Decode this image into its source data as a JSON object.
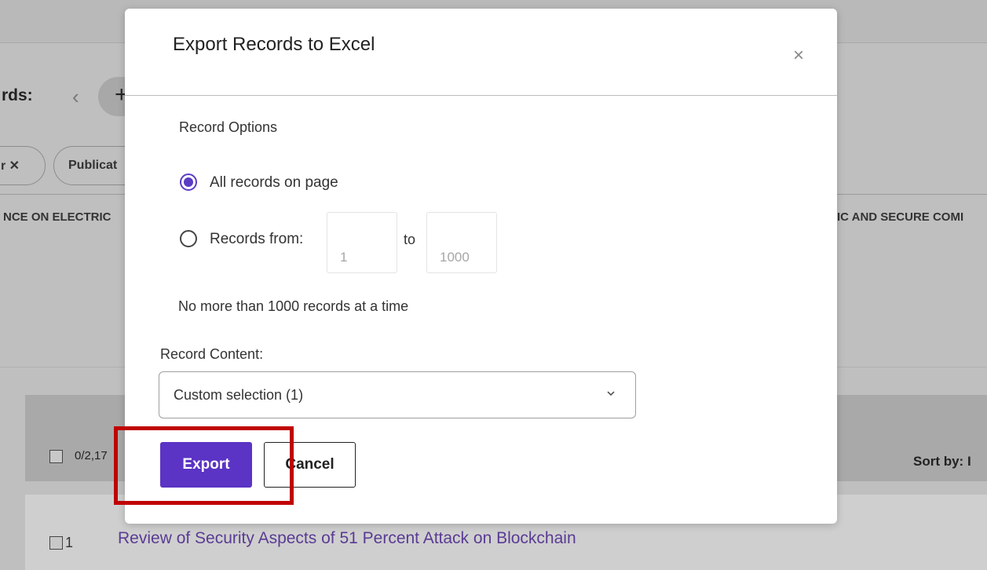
{
  "background": {
    "records_label": "rds:",
    "chevron_left": "‹",
    "plus": "+",
    "chip_author_close": "r ✕",
    "chip_publication": "Publicat",
    "banner_left": "NCE ON ELECTRIC",
    "banner_right": "IC AND SECURE COMI",
    "selected_count": "0/2,17",
    "sort_by": "Sort by: I",
    "result_index": "1",
    "result_title": "Review of Security Aspects of 51 Percent Attack on Blockchain"
  },
  "modal": {
    "title": "Export Records to Excel",
    "close_symbol": "×",
    "record_options_label": "Record Options",
    "options": [
      {
        "label": "All records on page",
        "checked": true
      },
      {
        "label": "Records from:",
        "checked": false
      }
    ],
    "from_placeholder": "1",
    "to_label": "to",
    "to_placeholder": "1000",
    "limit_note": "No more than 1000 records at a time",
    "content_label": "Record Content:",
    "content_selected": "Custom selection (1)",
    "export_label": "Export",
    "cancel_label": "Cancel"
  },
  "colors": {
    "accent": "#5b33c5",
    "highlight": "#c00000",
    "link": "#5a3b94"
  }
}
